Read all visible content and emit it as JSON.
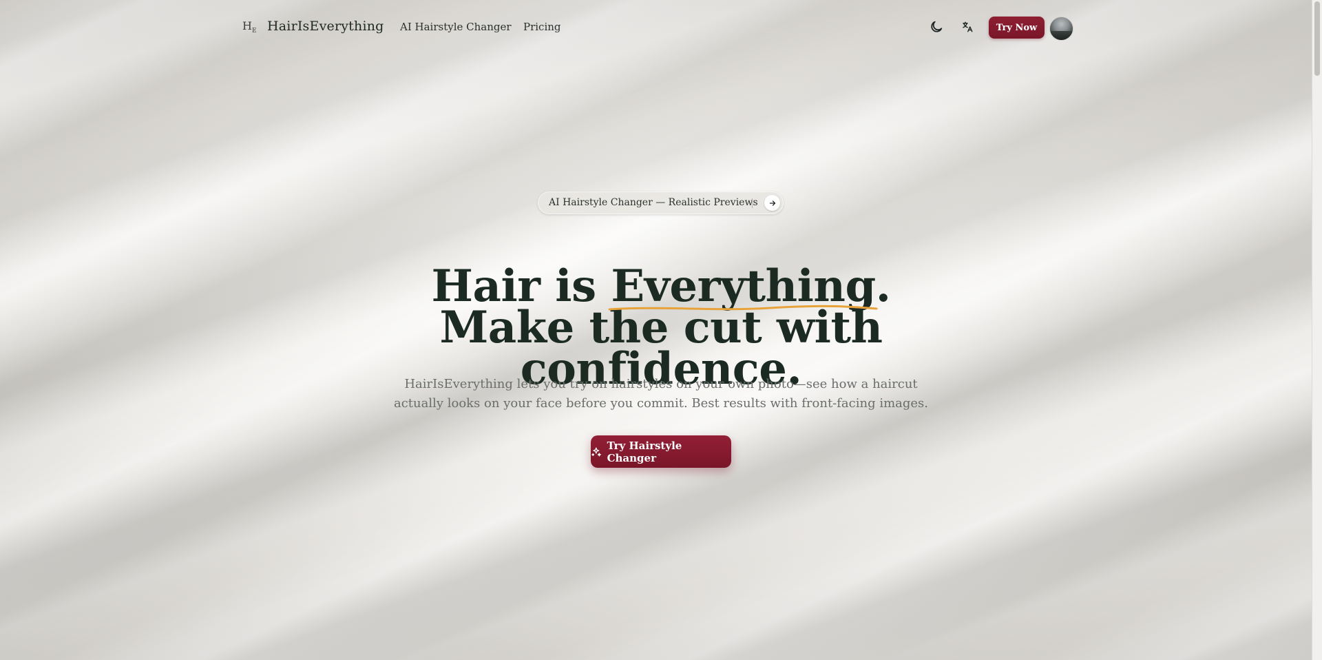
{
  "header": {
    "logo_mark": "H",
    "logo_mark_sub": "E",
    "brand": "HairIsEverything",
    "nav": [
      {
        "label": "AI Hairstyle Changer"
      },
      {
        "label": "Pricing"
      }
    ],
    "moon_icon": "moon-icon",
    "translate_icon": "translate-icon",
    "try_now_label": "Try Now",
    "avatar_icon": "avatar-photo"
  },
  "announcement": {
    "text": "AI Hairstyle Changer — Realistic Previews",
    "arrow_icon": "arrow-right-icon"
  },
  "hero": {
    "title_part1": "Hair is ",
    "title_highlight": "Everything",
    "title_part2": ". Make the cut with confidence.",
    "subtitle": "HairIsEverything lets you try on hairstyles on your own photo—see how a haircut actually looks on your face before you commit. Best results with front-facing images.",
    "cta_label": "Try Hairstyle Changer",
    "cta_icon": "sparkles-icon"
  },
  "colors": {
    "accent": "#8e1f33",
    "underline": "#e8a23a",
    "text": "#1c2a24",
    "muted": "#6a6e6b"
  }
}
